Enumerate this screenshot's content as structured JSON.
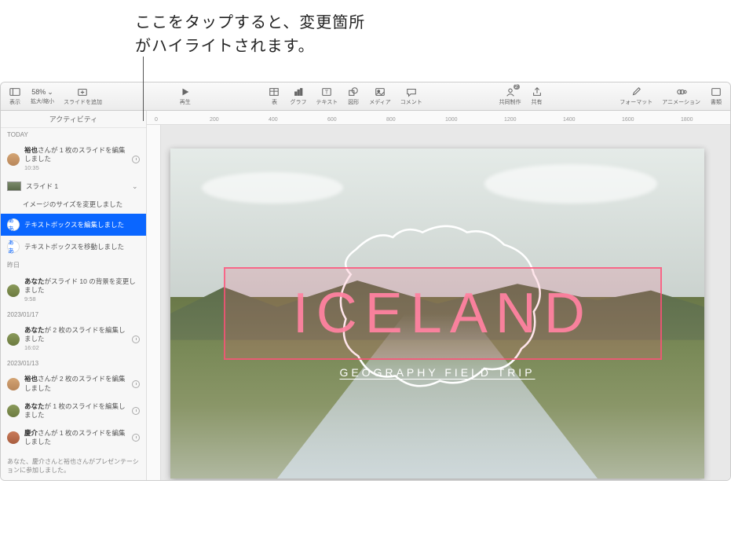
{
  "annotation": {
    "line1": "ここをタップすると、変更箇所",
    "line2": "がハイライトされます。"
  },
  "toolbar": {
    "view": "表示",
    "zoom": "拡大/縮小",
    "zoom_value": "58%",
    "add_slide": "スライドを追加",
    "play": "再生",
    "table": "表",
    "chart": "グラフ",
    "text": "テキスト",
    "shape": "図形",
    "media": "メディア",
    "comment": "コメント",
    "collab": "共同制作",
    "collab_count": "2",
    "share": "共有",
    "format": "フォーマット",
    "animation": "アニメーション",
    "document": "書類"
  },
  "sidebar": {
    "title": "アクティビティ",
    "sections": {
      "today": "TODAY",
      "yesterday": "昨日",
      "date1": "2023/01/17",
      "date2": "2023/01/13"
    },
    "items": {
      "i0": {
        "user": "裕也",
        "suffix": "さんが 1 枚のスライドを編集しました",
        "time": "10:35"
      },
      "slide1_label": "スライド 1",
      "i1": {
        "text": "イメージのサイズを変更しました"
      },
      "i2": {
        "badge": "ぁあ",
        "text": "テキストボックスを編集しました"
      },
      "i3": {
        "badge": "ぁあ",
        "text": "テキストボックスを移動しました"
      },
      "i4": {
        "user": "あなた",
        "suffix": "がスライド 10 の背景を変更しました",
        "time": "9:58"
      },
      "i5": {
        "user": "あなた",
        "suffix": "が 2 枚のスライドを編集しました",
        "time": "16:02"
      },
      "i6": {
        "user": "裕也",
        "suffix": "さんが 2 枚のスライドを編集しました"
      },
      "i7": {
        "user": "あなた",
        "suffix": "が 1 枚のスライドを編集しました"
      },
      "i8": {
        "user": "慶介",
        "suffix": "さんが 1 枚のスライドを編集しました"
      }
    },
    "footer": "あなた、慶介さんと裕也さんがプレゼンテーションに参加しました。"
  },
  "ruler": {
    "t0": "0",
    "t200": "200",
    "t400": "400",
    "t600": "600",
    "t800": "800",
    "t1000": "1000",
    "t1200": "1200",
    "t1400": "1400",
    "t1600": "1600",
    "t1800": "1800"
  },
  "slide": {
    "title": "ICELAND",
    "subtitle": "GEOGRAPHY FIELD TRIP"
  }
}
